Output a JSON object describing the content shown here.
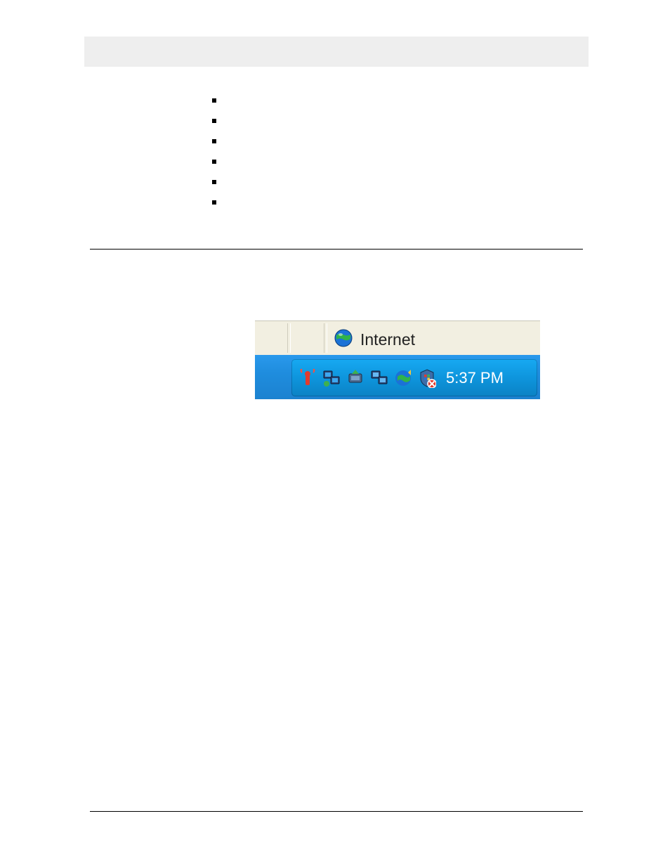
{
  "ie_status": {
    "zone_label": "Internet"
  },
  "taskbar": {
    "clock": "5:37 PM",
    "icons": [
      "honeypoint-agent-icon",
      "network-connection-icon",
      "safely-remove-hardware-icon",
      "network-connection-2-icon",
      "windows-update-icon",
      "windows-security-alert-icon"
    ]
  }
}
